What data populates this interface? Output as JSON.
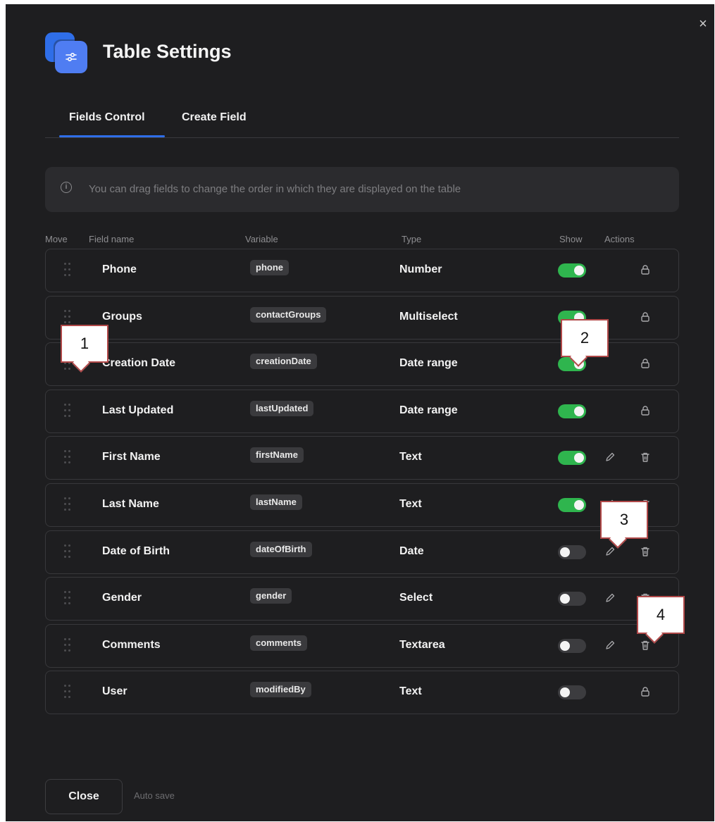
{
  "dialog": {
    "title": "Table Settings",
    "close_glyph": "×",
    "tabs": [
      {
        "label": "Fields Control",
        "active": true
      },
      {
        "label": "Create Field",
        "active": false
      }
    ],
    "info": {
      "icon": "info-icon",
      "text": "You can drag fields to change the order in which they are displayed on the table"
    },
    "columns": {
      "move": "Move",
      "field_name": "Field name",
      "variable": "Variable",
      "type": "Type",
      "show": "Show",
      "actions": "Actions"
    },
    "rows": [
      {
        "name": "Phone",
        "variable": "phone",
        "type": "Number",
        "show": true,
        "actions": [
          "lock-icon"
        ]
      },
      {
        "name": "Groups",
        "variable": "contactGroups",
        "type": "Multiselect",
        "show": true,
        "actions": [
          "lock-icon"
        ]
      },
      {
        "name": "Creation Date",
        "variable": "creationDate",
        "type": "Date range",
        "show": true,
        "actions": [
          "lock-icon"
        ]
      },
      {
        "name": "Last Updated",
        "variable": "lastUpdated",
        "type": "Date range",
        "show": true,
        "actions": [
          "lock-icon"
        ]
      },
      {
        "name": "First Name",
        "variable": "firstName",
        "type": "Text",
        "show": true,
        "actions": [
          "edit-icon",
          "trash-icon"
        ]
      },
      {
        "name": "Last Name",
        "variable": "lastName",
        "type": "Text",
        "show": true,
        "actions": [
          "edit-icon",
          "trash-icon"
        ]
      },
      {
        "name": "Date of Birth",
        "variable": "dateOfBirth",
        "type": "Date",
        "show": false,
        "actions": [
          "edit-icon",
          "trash-icon"
        ]
      },
      {
        "name": "Gender",
        "variable": "gender",
        "type": "Select",
        "show": false,
        "actions": [
          "edit-icon",
          "trash-icon"
        ]
      },
      {
        "name": "Comments",
        "variable": "comments",
        "type": "Textarea",
        "show": false,
        "actions": [
          "edit-icon",
          "trash-icon"
        ]
      },
      {
        "name": "User",
        "variable": "modifiedBy",
        "type": "Text",
        "show": false,
        "actions": [
          "lock-icon"
        ]
      }
    ],
    "footer": {
      "close_label": "Close",
      "autosave_label": "Auto save"
    }
  },
  "callouts": [
    "1",
    "2",
    "3",
    "4"
  ],
  "colors": {
    "background": "#1e1e20",
    "accent": "#2f6ee8",
    "toggle_on": "#2fb54e",
    "toggle_off": "#3c3c3f",
    "callout_border": "#b04848"
  }
}
